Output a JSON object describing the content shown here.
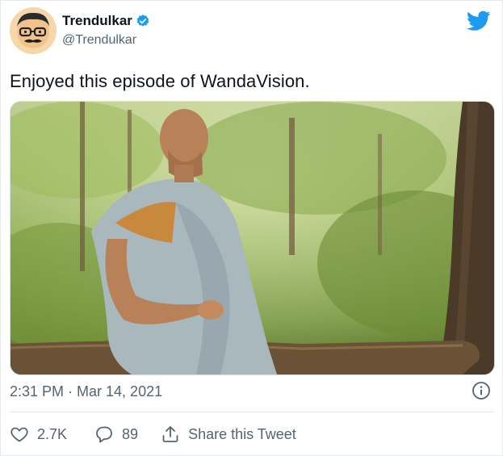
{
  "user": {
    "name": "Trendulkar",
    "handle": "@Trendulkar",
    "verified": true
  },
  "tweet": {
    "text": "Enjoyed this episode of WandaVision.",
    "timestamp": "2:31 PM · Mar 14, 2021"
  },
  "actions": {
    "likes": "2.7K",
    "replies": "89",
    "share_label": "Share this Tweet"
  },
  "icons": {
    "logo": "twitter-bird-icon",
    "verified": "verified-badge-icon",
    "info": "info-icon",
    "like": "heart-icon",
    "reply": "reply-icon",
    "share": "share-icon"
  },
  "colors": {
    "brand": "#1d9bf0",
    "text": "#0f1419",
    "secondary": "#536471"
  }
}
